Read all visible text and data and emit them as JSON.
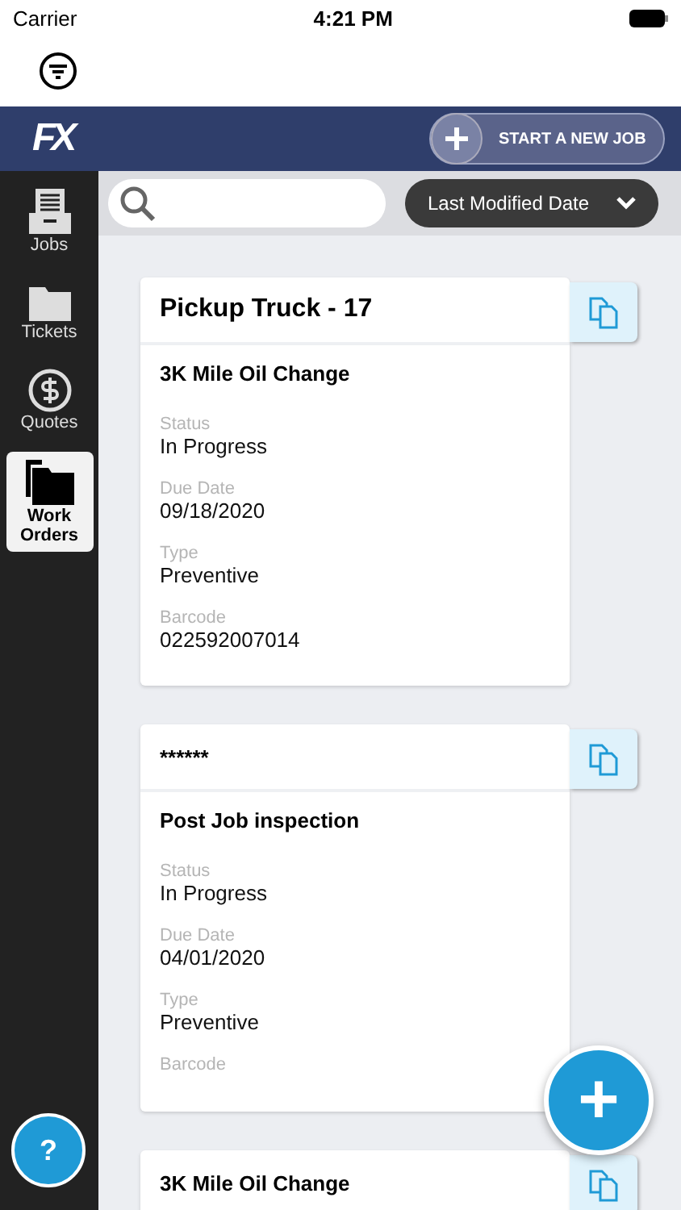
{
  "status_bar": {
    "carrier": "Carrier",
    "time": "4:21 PM"
  },
  "header": {
    "logo": "FX",
    "new_job_button": "START A NEW JOB"
  },
  "sidebar": {
    "items": [
      {
        "label": "Jobs",
        "selected": false
      },
      {
        "label": "Tickets",
        "selected": false
      },
      {
        "label": "Quotes",
        "selected": false
      },
      {
        "label": "Work Orders",
        "selected": true
      }
    ],
    "help_button": "?"
  },
  "toolbar": {
    "sort": {
      "value": "Last Modified Date"
    }
  },
  "cards": [
    {
      "title": "Pickup Truck - 17",
      "subtitle": "3K Mile Oil Change",
      "fields": [
        {
          "label": "Status",
          "value": "In Progress"
        },
        {
          "label": "Due Date",
          "value": "09/18/2020"
        },
        {
          "label": "Type",
          "value": "Preventive"
        },
        {
          "label": "Barcode",
          "value": "022592007014"
        }
      ]
    },
    {
      "title": "******",
      "subtitle": "Post Job inspection",
      "fields": [
        {
          "label": "Status",
          "value": "In Progress"
        },
        {
          "label": "Due Date",
          "value": "04/01/2020"
        },
        {
          "label": "Type",
          "value": "Preventive"
        },
        {
          "label": "Barcode"
        }
      ]
    },
    {
      "title": "3K Mile Oil Change"
    }
  ],
  "fab": {
    "label": "+"
  }
}
